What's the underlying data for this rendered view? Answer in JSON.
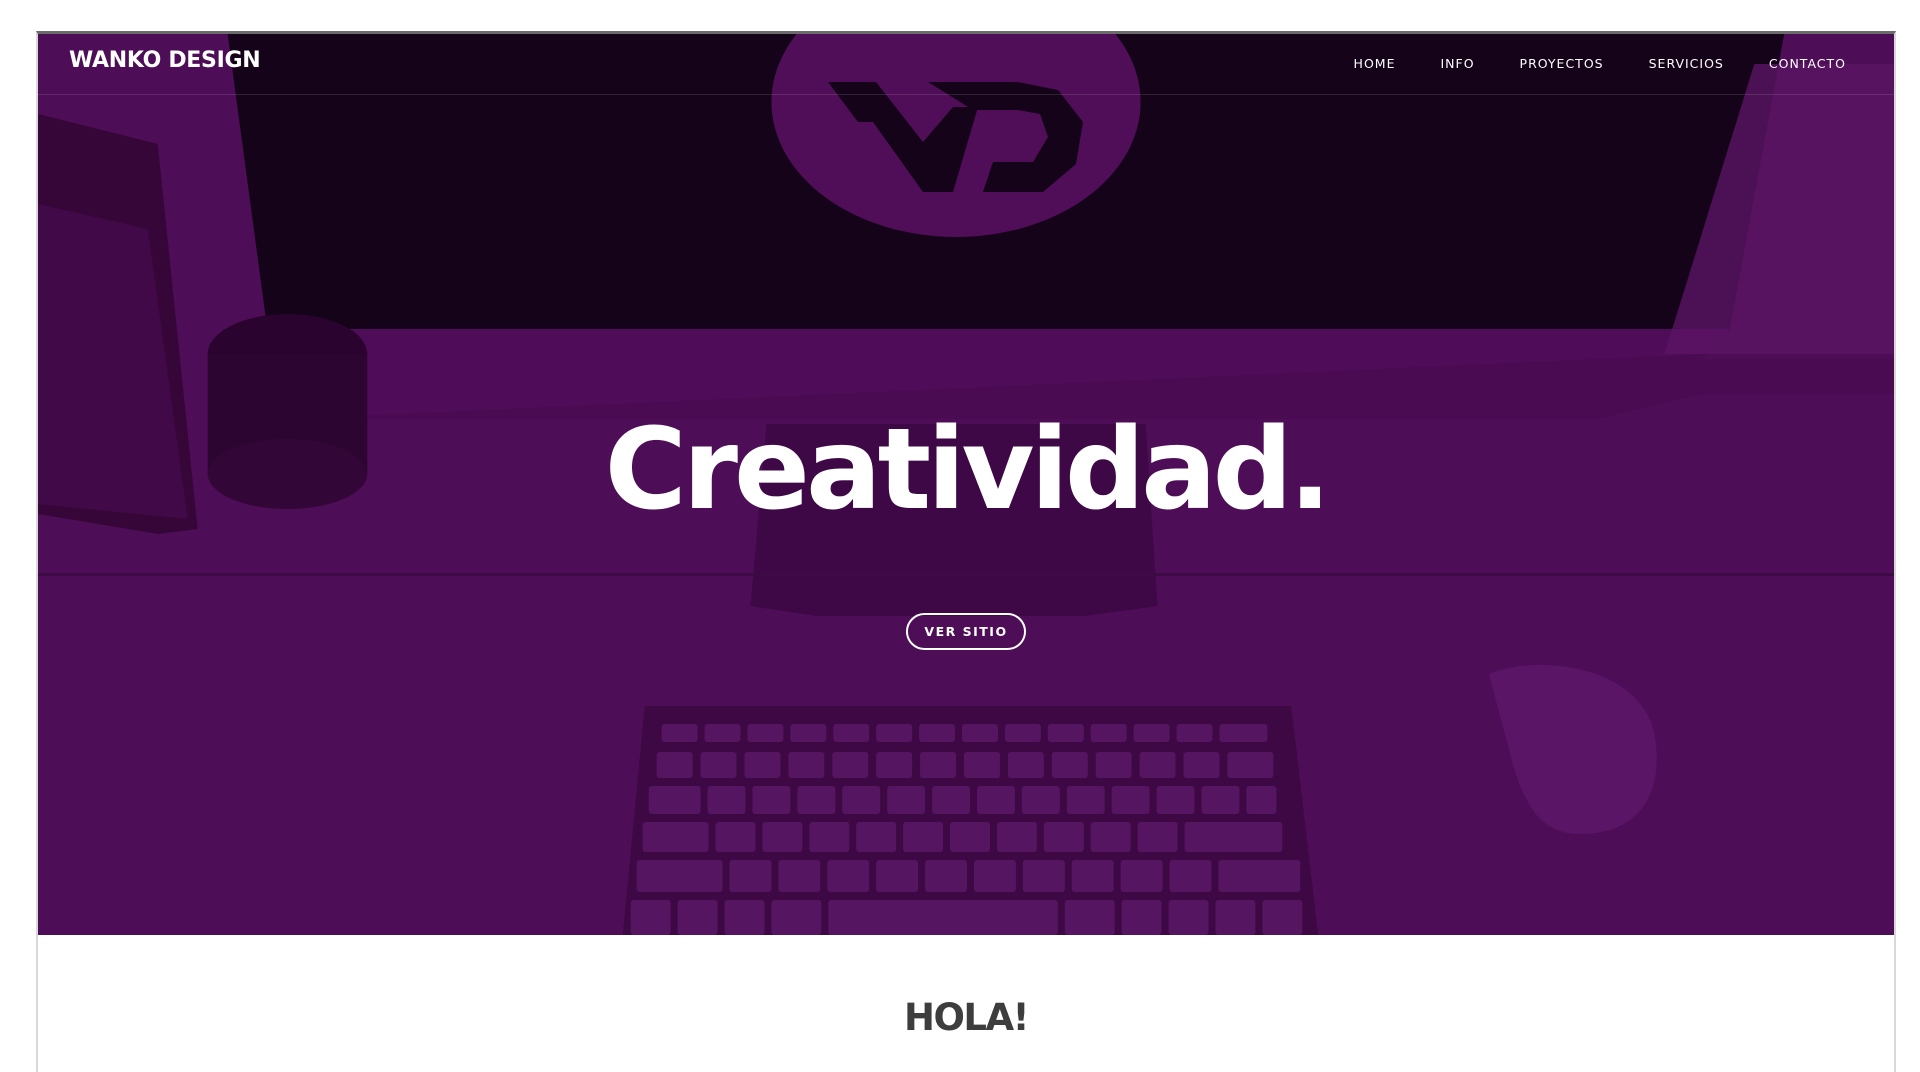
{
  "site": {
    "brand": "WANKO DESIGN"
  },
  "nav": {
    "items": [
      {
        "label": "HOME"
      },
      {
        "label": "INFO"
      },
      {
        "label": "PROYECTOS"
      },
      {
        "label": "SERVICIOS"
      },
      {
        "label": "CONTACTO"
      }
    ]
  },
  "hero": {
    "title": "Creatividad.",
    "button_label": "VER SITIO",
    "overlay_color": "#4d0c55",
    "background_icon": "desk-workspace-photo"
  },
  "intro": {
    "title": "HOLA!"
  },
  "colors": {
    "accent": "#4d0c55",
    "text_dark": "#3d3d3d",
    "white": "#ffffff"
  }
}
